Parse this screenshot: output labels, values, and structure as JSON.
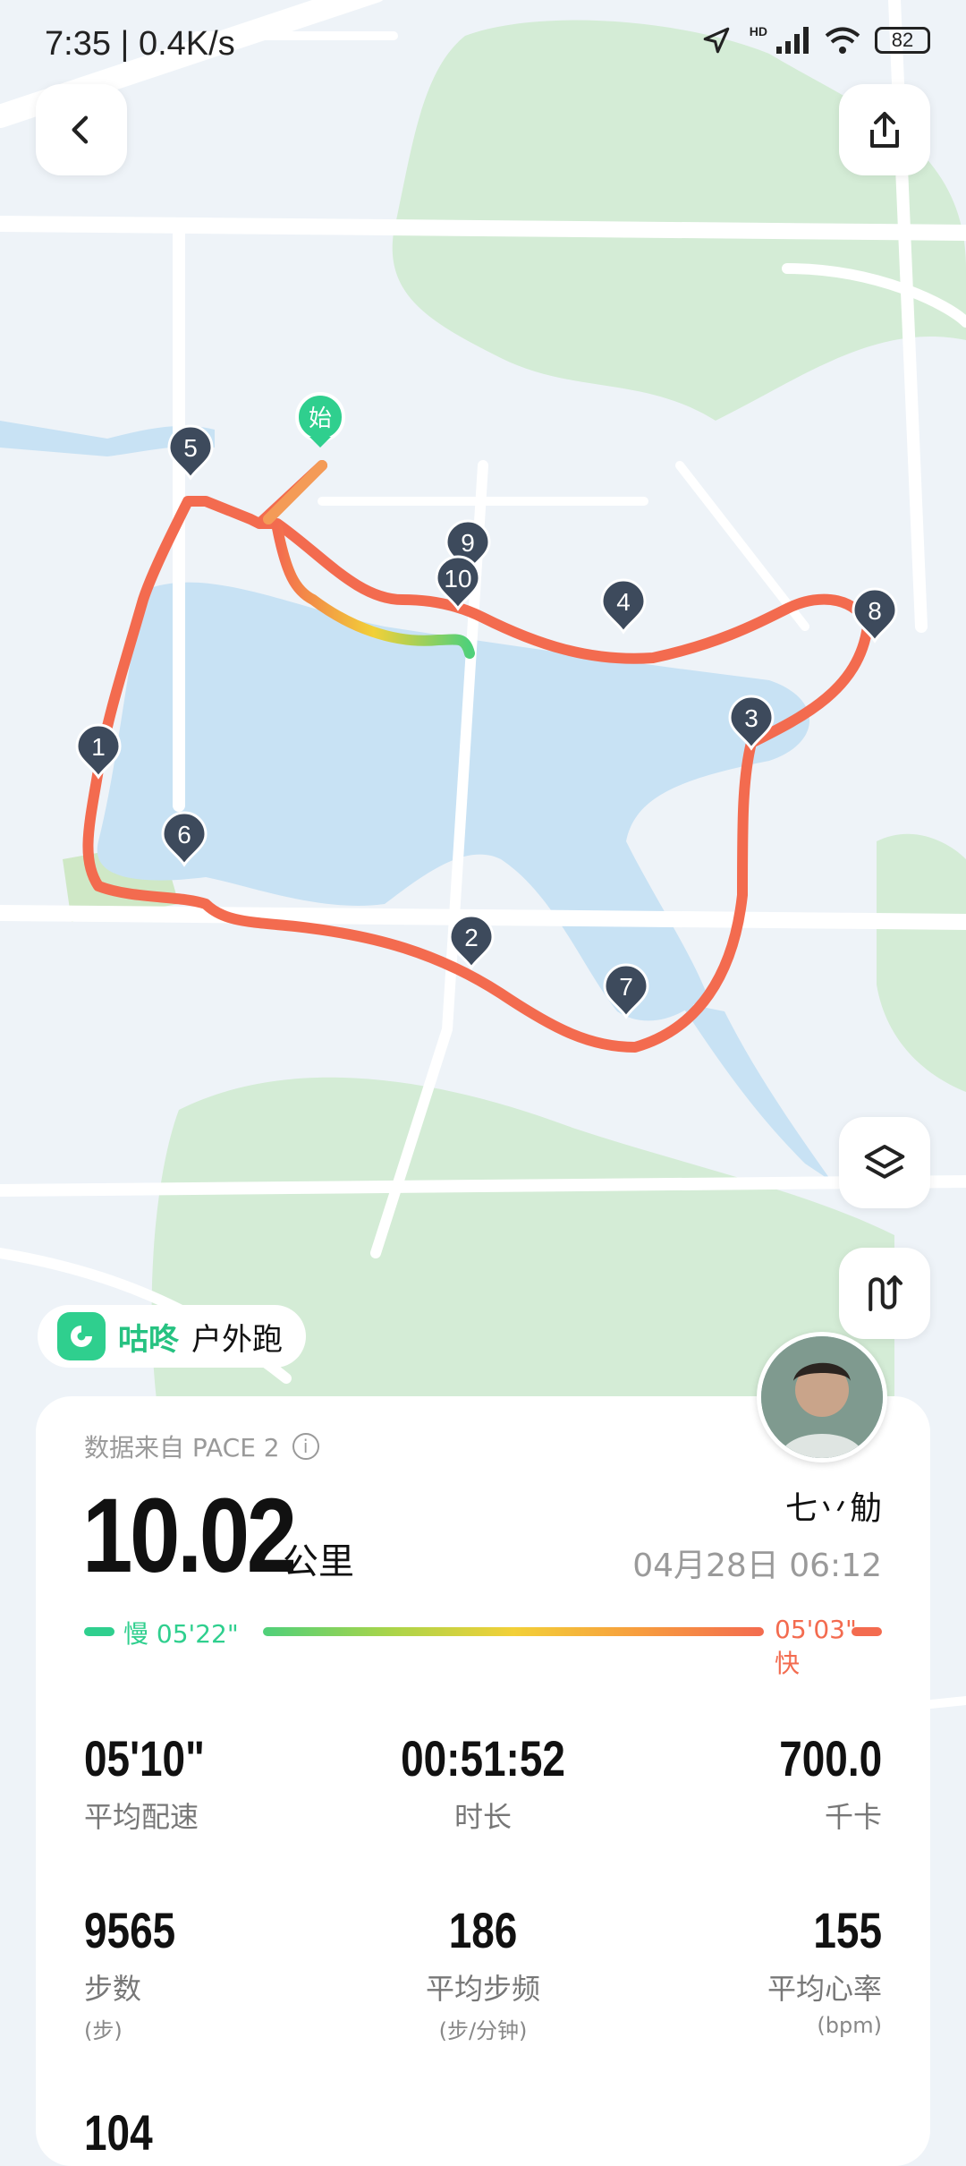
{
  "status_bar": {
    "time": "7:35",
    "net_speed": "0.4K/s",
    "hd": "HD",
    "battery": "82"
  },
  "map": {
    "start_badge": "始",
    "km_markers": [
      "1",
      "2",
      "3",
      "4",
      "5",
      "6",
      "7",
      "8",
      "9",
      "10"
    ],
    "route_color": "#f36b4f"
  },
  "tag": {
    "app_name": "咕咚",
    "sport_type": "户外跑"
  },
  "summary": {
    "source": "数据来自 PACE 2",
    "info": "i",
    "distance": "10.02",
    "distance_unit": "公里",
    "username": "七丷觔",
    "datetime": "04月28日 06:12",
    "pace_slow_label": "慢 05'22\"",
    "pace_fast_label": "05'03\" 快"
  },
  "stats": [
    {
      "value": "05'10\"",
      "label": "平均配速",
      "unit": ""
    },
    {
      "value": "00:51:52",
      "label": "时长",
      "unit": ""
    },
    {
      "value": "700.0",
      "label": "千卡",
      "unit": ""
    },
    {
      "value": "9565",
      "label": "步数",
      "unit": "(步)"
    },
    {
      "value": "186",
      "label": "平均步频",
      "unit": "(步/分钟)"
    },
    {
      "value": "155",
      "label": "平均心率",
      "unit": "(bpm)"
    },
    {
      "value": "104",
      "label": "",
      "unit": ""
    }
  ],
  "colors": {
    "accent_green": "#2fcf8e",
    "accent_red": "#f36b4f",
    "marker": "#3d4a5c"
  }
}
